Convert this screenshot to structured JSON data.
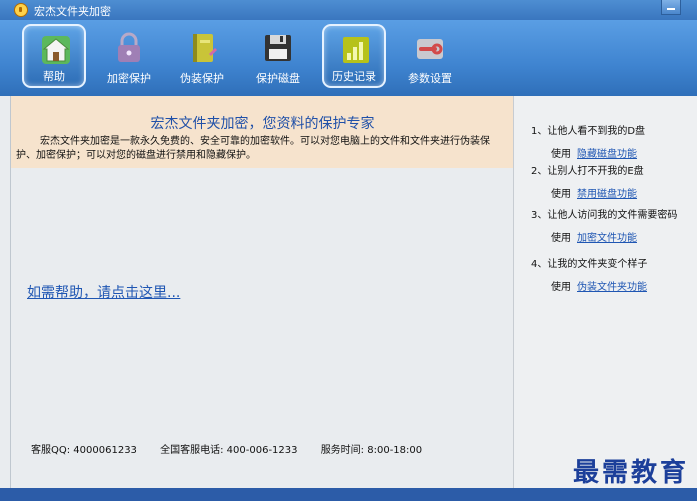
{
  "window": {
    "title": "宏杰文件夹加密"
  },
  "toolbar": {
    "items": [
      {
        "label": "帮助",
        "icon": "house-icon"
      },
      {
        "label": "加密保护",
        "icon": "lock-icon"
      },
      {
        "label": "伪装保护",
        "icon": "notebook-icon"
      },
      {
        "label": "保护磁盘",
        "icon": "floppy-disk-icon"
      },
      {
        "label": "历史记录",
        "icon": "bar-chart-icon"
      },
      {
        "label": "参数设置",
        "icon": "wrench-icon"
      }
    ]
  },
  "banner": {
    "headline": "宏杰文件夹加密，您资料的保护专家",
    "description": "宏杰文件夹加密是一款永久免费的、安全可靠的加密软件。可以对您电脑上的文件和文件夹进行伪装保护、加密保护；可以对您的磁盘进行禁用和隐藏保护。"
  },
  "help_link": "如需帮助，请点击这里...",
  "footer": {
    "qq": "客服QQ: 4000061233",
    "phone": "全国客服电话: 400-006-1233",
    "hours": "服务时间: 8:00-18:00"
  },
  "tips": [
    {
      "question": "1、让他人看不到我的D盘",
      "use": "使用",
      "link": "隐藏磁盘功能"
    },
    {
      "question": "2、让别人打不开我的E盘",
      "use": "使用",
      "link": "禁用磁盘功能"
    },
    {
      "question": "3、让他人访问我的文件需要密码",
      "use": "使用",
      "link": "加密文件功能"
    },
    {
      "question": "4、让我的文件夹变个样子",
      "use": "使用",
      "link": "伪装文件夹功能"
    }
  ],
  "watermark": "最需教育"
}
